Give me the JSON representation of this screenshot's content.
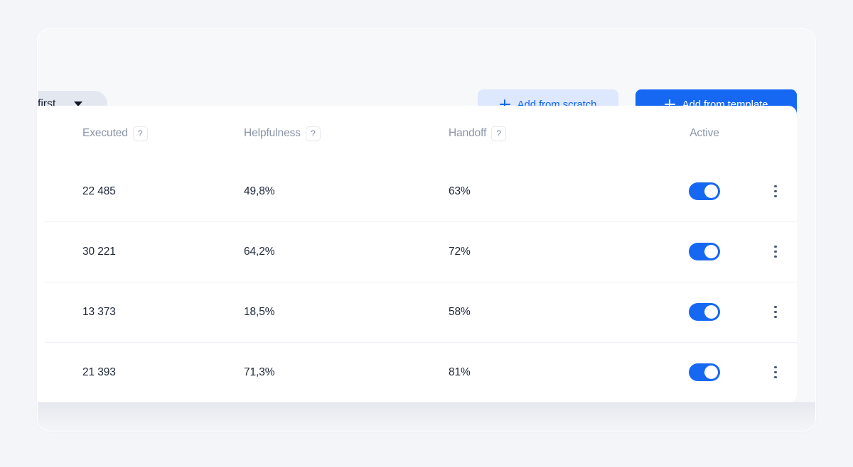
{
  "page": {
    "background_color": "#f4f5f8"
  },
  "toolbar": {
    "filter": {
      "label": "first",
      "icon": "chevron-down-icon"
    },
    "add_from_scratch": {
      "label": "Add from scratch",
      "icon": "plus-icon",
      "background_color": "#dde7fd",
      "text_color": "#1166f1"
    },
    "add_from_template": {
      "label": "Add from template",
      "icon": "plus-icon",
      "background_color": "#1668f3",
      "text_color": "#ffffff"
    }
  },
  "table": {
    "columns": [
      {
        "key": "executed",
        "label": "Executed",
        "has_help": true
      },
      {
        "key": "helpfulness",
        "label": "Helpfulness",
        "has_help": true
      },
      {
        "key": "handoff",
        "label": "Handoff",
        "has_help": true
      },
      {
        "key": "active",
        "label": "Active",
        "has_help": false
      }
    ],
    "help_badge_label": "?",
    "rows": [
      {
        "executed": "22 485",
        "helpfulness": "49,8%",
        "handoff": "63%",
        "active": true,
        "menu_icon": "kebab-menu-icon"
      },
      {
        "executed": "30 221",
        "helpfulness": "64,2%",
        "handoff": "72%",
        "active": true,
        "menu_icon": "kebab-menu-icon"
      },
      {
        "executed": "13 373",
        "helpfulness": "18,5%",
        "handoff": "58%",
        "active": true,
        "menu_icon": "kebab-menu-icon"
      },
      {
        "executed": "21 393",
        "helpfulness": "71,3%",
        "handoff": "81%",
        "active": true,
        "menu_icon": "kebab-menu-icon"
      }
    ],
    "toggle_on_color": "#1668f3"
  }
}
